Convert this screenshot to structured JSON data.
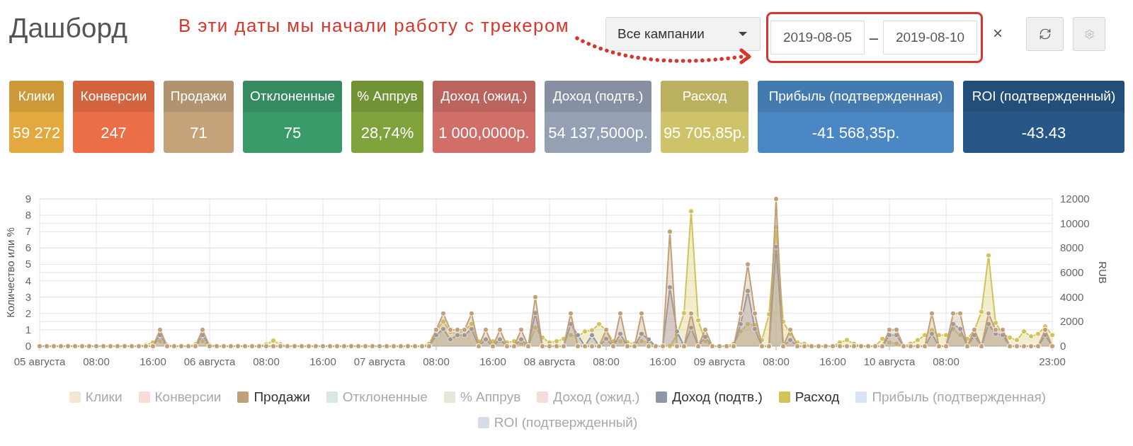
{
  "page": {
    "title": "Дашборд"
  },
  "annotation": {
    "text": "В эти даты мы начали работу с трекером"
  },
  "filters": {
    "campaign": {
      "value": "Все кампании"
    },
    "date_from": {
      "value": "2019-08-05"
    },
    "separator": "–",
    "date_to": {
      "value": "2019-08-10"
    },
    "clear": "×"
  },
  "metrics": [
    {
      "label": "Клики",
      "value": "59 272",
      "color": "#e3a93e"
    },
    {
      "label": "Конверсии",
      "value": "247",
      "color": "#ec6e46"
    },
    {
      "label": "Продажи",
      "value": "71",
      "color": "#c4a37b"
    },
    {
      "label": "Отклоненные",
      "value": "75",
      "color": "#3b9a69"
    },
    {
      "label": "% Аппрув",
      "value": "28,74%",
      "color": "#7fa23c"
    },
    {
      "label": "Доход (ожид.)",
      "value": "1 000,0000р.",
      "color": "#d06e67"
    },
    {
      "label": "Доход (подтв.)",
      "value": "54 137,5000р.",
      "color": "#95a0b4"
    },
    {
      "label": "Расход",
      "value": "95 705,85р.",
      "color": "#cfc369"
    },
    {
      "label": "Прибыль (подтвержденная)",
      "value": "-41 568,35р.",
      "color": "#4a87c4"
    },
    {
      "label": "ROI (подтвержденный)",
      "value": "-43.43",
      "color": "#275787"
    }
  ],
  "chart": {
    "chart_data": {
      "type": "area",
      "stacked": false,
      "grid": true,
      "legend": "bottom",
      "ylabel": "Количество или %",
      "y2label": "RUB",
      "x": [
        "2019-08-05T00:00",
        "2019-08-05T01:00",
        "2019-08-05T02:00",
        "2019-08-05T03:00",
        "2019-08-05T04:00",
        "2019-08-05T05:00",
        "2019-08-05T06:00",
        "2019-08-05T07:00",
        "2019-08-05T08:00",
        "2019-08-05T09:00",
        "2019-08-05T10:00",
        "2019-08-05T11:00",
        "2019-08-05T12:00",
        "2019-08-05T13:00",
        "2019-08-05T14:00",
        "2019-08-05T15:00",
        "2019-08-05T16:00",
        "2019-08-05T17:00",
        "2019-08-05T18:00",
        "2019-08-05T19:00",
        "2019-08-05T20:00",
        "2019-08-05T21:00",
        "2019-08-05T22:00",
        "2019-08-05T23:00",
        "2019-08-06T00:00",
        "2019-08-06T01:00",
        "2019-08-06T02:00",
        "2019-08-06T03:00",
        "2019-08-06T04:00",
        "2019-08-06T05:00",
        "2019-08-06T06:00",
        "2019-08-06T07:00",
        "2019-08-06T08:00",
        "2019-08-06T09:00",
        "2019-08-06T10:00",
        "2019-08-06T11:00",
        "2019-08-06T12:00",
        "2019-08-06T13:00",
        "2019-08-06T14:00",
        "2019-08-06T15:00",
        "2019-08-06T16:00",
        "2019-08-06T17:00",
        "2019-08-06T18:00",
        "2019-08-06T19:00",
        "2019-08-06T20:00",
        "2019-08-06T21:00",
        "2019-08-06T22:00",
        "2019-08-06T23:00",
        "2019-08-07T00:00",
        "2019-08-07T01:00",
        "2019-08-07T02:00",
        "2019-08-07T03:00",
        "2019-08-07T04:00",
        "2019-08-07T05:00",
        "2019-08-07T06:00",
        "2019-08-07T07:00",
        "2019-08-07T08:00",
        "2019-08-07T09:00",
        "2019-08-07T10:00",
        "2019-08-07T11:00",
        "2019-08-07T12:00",
        "2019-08-07T13:00",
        "2019-08-07T14:00",
        "2019-08-07T15:00",
        "2019-08-07T16:00",
        "2019-08-07T17:00",
        "2019-08-07T18:00",
        "2019-08-07T19:00",
        "2019-08-07T20:00",
        "2019-08-07T21:00",
        "2019-08-07T22:00",
        "2019-08-07T23:00",
        "2019-08-08T00:00",
        "2019-08-08T01:00",
        "2019-08-08T02:00",
        "2019-08-08T03:00",
        "2019-08-08T04:00",
        "2019-08-08T05:00",
        "2019-08-08T06:00",
        "2019-08-08T07:00",
        "2019-08-08T08:00",
        "2019-08-08T09:00",
        "2019-08-08T10:00",
        "2019-08-08T11:00",
        "2019-08-08T12:00",
        "2019-08-08T13:00",
        "2019-08-08T14:00",
        "2019-08-08T15:00",
        "2019-08-08T16:00",
        "2019-08-08T17:00",
        "2019-08-08T18:00",
        "2019-08-08T19:00",
        "2019-08-08T20:00",
        "2019-08-08T21:00",
        "2019-08-08T22:00",
        "2019-08-08T23:00",
        "2019-08-09T00:00",
        "2019-08-09T01:00",
        "2019-08-09T02:00",
        "2019-08-09T03:00",
        "2019-08-09T04:00",
        "2019-08-09T05:00",
        "2019-08-09T06:00",
        "2019-08-09T07:00",
        "2019-08-09T08:00",
        "2019-08-09T09:00",
        "2019-08-09T10:00",
        "2019-08-09T11:00",
        "2019-08-09T12:00",
        "2019-08-09T13:00",
        "2019-08-09T14:00",
        "2019-08-09T15:00",
        "2019-08-09T16:00",
        "2019-08-09T17:00",
        "2019-08-09T18:00",
        "2019-08-09T19:00",
        "2019-08-09T20:00",
        "2019-08-09T21:00",
        "2019-08-09T22:00",
        "2019-08-09T23:00",
        "2019-08-10T00:00",
        "2019-08-10T01:00",
        "2019-08-10T02:00",
        "2019-08-10T03:00",
        "2019-08-10T04:00",
        "2019-08-10T05:00",
        "2019-08-10T06:00",
        "2019-08-10T07:00",
        "2019-08-10T08:00",
        "2019-08-10T09:00",
        "2019-08-10T10:00",
        "2019-08-10T11:00",
        "2019-08-10T12:00",
        "2019-08-10T13:00",
        "2019-08-10T14:00",
        "2019-08-10T15:00",
        "2019-08-10T16:00",
        "2019-08-10T17:00",
        "2019-08-10T18:00",
        "2019-08-10T19:00",
        "2019-08-10T20:00",
        "2019-08-10T21:00",
        "2019-08-10T22:00",
        "2019-08-10T23:00"
      ],
      "xlim": [
        "2019-08-05T00:00",
        "2019-08-10T23:00"
      ],
      "xticks": [
        {
          "value": "2019-08-05T00:00",
          "label": "05 августа"
        },
        {
          "value": "2019-08-05T08:00",
          "label": "08:00"
        },
        {
          "value": "2019-08-05T16:00",
          "label": "16:00"
        },
        {
          "value": "2019-08-06T00:00",
          "label": "06 августа"
        },
        {
          "value": "2019-08-06T08:00",
          "label": "08:00"
        },
        {
          "value": "2019-08-06T16:00",
          "label": "16:00"
        },
        {
          "value": "2019-08-07T00:00",
          "label": "07 августа"
        },
        {
          "value": "2019-08-07T08:00",
          "label": "08:00"
        },
        {
          "value": "2019-08-07T16:00",
          "label": "16:00"
        },
        {
          "value": "2019-08-08T00:00",
          "label": "08 августа"
        },
        {
          "value": "2019-08-08T08:00",
          "label": "08:00"
        },
        {
          "value": "2019-08-08T16:00",
          "label": "16:00"
        },
        {
          "value": "2019-08-09T00:00",
          "label": "09 августа"
        },
        {
          "value": "2019-08-09T08:00",
          "label": "08:00"
        },
        {
          "value": "2019-08-09T16:00",
          "label": "16:00"
        },
        {
          "value": "2019-08-10T00:00",
          "label": "10 августа"
        },
        {
          "value": "2019-08-10T08:00",
          "label": "08:00"
        },
        {
          "value": "2019-08-10T23:00",
          "label": "23:00"
        }
      ],
      "ylim": [
        0,
        9
      ],
      "yticks": [
        0,
        1,
        2,
        3,
        4,
        5,
        6,
        7,
        8,
        9
      ],
      "y2lim": [
        0,
        12000
      ],
      "y2ticks": [
        0,
        2000,
        4000,
        6000,
        8000,
        10000,
        12000
      ],
      "series": [
        {
          "name": "Клики",
          "color": "#f5e7cf",
          "values": [
            null,
            null,
            null,
            null,
            null,
            null,
            null,
            null,
            null,
            null,
            null,
            null,
            null,
            null,
            null,
            null,
            null,
            null,
            null,
            null,
            null,
            null,
            null,
            null,
            null,
            null,
            null,
            null,
            null,
            null,
            null,
            null,
            null,
            null,
            null,
            null,
            null,
            null,
            null,
            null,
            null,
            null,
            null,
            null,
            null,
            null,
            null,
            null,
            null,
            null,
            null,
            null,
            null,
            null,
            null,
            null,
            null,
            null,
            null,
            null,
            null,
            null,
            null,
            null,
            null,
            null,
            null,
            null,
            null,
            null,
            null,
            null,
            null,
            null,
            null,
            null,
            null,
            null,
            null,
            null,
            null,
            null,
            null,
            null,
            null,
            null,
            null,
            null,
            null,
            null,
            null,
            null,
            null,
            null,
            null,
            null,
            null,
            null,
            null,
            null,
            null,
            null,
            null,
            null,
            null,
            null,
            null,
            null,
            null,
            null,
            null,
            null,
            null,
            null,
            null,
            null,
            null,
            null,
            null,
            null,
            null,
            null,
            null,
            null,
            null,
            null,
            null,
            null,
            null,
            null,
            null,
            null,
            null,
            null,
            null,
            null,
            null,
            null,
            null,
            null,
            null,
            null,
            null,
            null
          ]
        },
        {
          "name": "Конверсии",
          "color": "#f9dcd3",
          "values": [
            null,
            null,
            null,
            null,
            null,
            null,
            null,
            null,
            null,
            null,
            null,
            null,
            null,
            null,
            null,
            null,
            null,
            null,
            null,
            null,
            null,
            null,
            null,
            null,
            null,
            null,
            null,
            null,
            null,
            null,
            null,
            null,
            null,
            null,
            null,
            null,
            null,
            null,
            null,
            null,
            null,
            null,
            null,
            null,
            null,
            null,
            null,
            null,
            null,
            null,
            null,
            null,
            null,
            null,
            null,
            null,
            null,
            null,
            null,
            null,
            null,
            null,
            null,
            null,
            null,
            null,
            null,
            null,
            null,
            null,
            null,
            null,
            null,
            null,
            null,
            null,
            null,
            null,
            null,
            null,
            null,
            null,
            null,
            null,
            null,
            null,
            null,
            null,
            null,
            null,
            null,
            null,
            null,
            null,
            null,
            null,
            null,
            null,
            null,
            null,
            null,
            null,
            null,
            null,
            null,
            null,
            null,
            null,
            null,
            null,
            null,
            null,
            null,
            null,
            null,
            null,
            null,
            null,
            null,
            null,
            null,
            null,
            null,
            null,
            null,
            null,
            null,
            null,
            null,
            null,
            null,
            null,
            null,
            null,
            null,
            null,
            null,
            null,
            null,
            null,
            null,
            null,
            null,
            null
          ]
        },
        {
          "name": "Продажи",
          "color": "#c2a077",
          "values": [
            0,
            0,
            0,
            0,
            0,
            0,
            0,
            0,
            0,
            0,
            0,
            0,
            0,
            0,
            0,
            0,
            0,
            1,
            0,
            0,
            0,
            0,
            0,
            1,
            0,
            0,
            0,
            0,
            0,
            0,
            0,
            0,
            0,
            0,
            0,
            0,
            0,
            0,
            0,
            0,
            0,
            0,
            0,
            0,
            0,
            0,
            0,
            0,
            0,
            0,
            0,
            0,
            0,
            0,
            0,
            0,
            1,
            2,
            1,
            1,
            1,
            2,
            0,
            1,
            0,
            1,
            0,
            0,
            1,
            0,
            3,
            0,
            0,
            0,
            0,
            2,
            0,
            0,
            0,
            0,
            1,
            0,
            2,
            0,
            0,
            2,
            0,
            0,
            0,
            7,
            0,
            0,
            2,
            0,
            1,
            0,
            0,
            0,
            0,
            2,
            5,
            2,
            0,
            0,
            9,
            0,
            1,
            0,
            0,
            0,
            0,
            0,
            0,
            0,
            0,
            0,
            0,
            0,
            0,
            0,
            1,
            1,
            0,
            0,
            0,
            0,
            2,
            0,
            0,
            2,
            2,
            0,
            1,
            0,
            2,
            1,
            1,
            0,
            0,
            0,
            0,
            0,
            1,
            0
          ]
        },
        {
          "name": "Отклоненные",
          "color": "#d6ebe0",
          "values": [
            null,
            null,
            null,
            null,
            null,
            null,
            null,
            null,
            null,
            null,
            null,
            null,
            null,
            null,
            null,
            null,
            null,
            null,
            null,
            null,
            null,
            null,
            null,
            null,
            null,
            null,
            null,
            null,
            null,
            null,
            null,
            null,
            null,
            null,
            null,
            null,
            null,
            null,
            null,
            null,
            null,
            null,
            null,
            null,
            null,
            null,
            null,
            null,
            null,
            null,
            null,
            null,
            null,
            null,
            null,
            null,
            null,
            null,
            null,
            null,
            null,
            null,
            null,
            null,
            null,
            null,
            null,
            null,
            null,
            null,
            null,
            null,
            null,
            null,
            null,
            null,
            null,
            null,
            null,
            null,
            null,
            null,
            null,
            null,
            null,
            null,
            null,
            null,
            null,
            null,
            null,
            null,
            null,
            null,
            null,
            null,
            null,
            null,
            null,
            null,
            null,
            null,
            null,
            null,
            null,
            null,
            null,
            null,
            null,
            null,
            null,
            null,
            null,
            null,
            null,
            null,
            null,
            null,
            null,
            null,
            null,
            null,
            null,
            null,
            null,
            null,
            null,
            null,
            null,
            null,
            null,
            null,
            null,
            null,
            null,
            null,
            null,
            null,
            null,
            null,
            null,
            null,
            null,
            null
          ]
        },
        {
          "name": "% Аппрув",
          "color": "#e3e9d3",
          "values": [
            null,
            null,
            null,
            null,
            null,
            null,
            null,
            null,
            null,
            null,
            null,
            null,
            null,
            null,
            null,
            null,
            null,
            null,
            null,
            null,
            null,
            null,
            null,
            null,
            null,
            null,
            null,
            null,
            null,
            null,
            null,
            null,
            null,
            null,
            null,
            null,
            null,
            null,
            null,
            null,
            null,
            null,
            null,
            null,
            null,
            null,
            null,
            null,
            null,
            null,
            null,
            null,
            null,
            null,
            null,
            null,
            null,
            null,
            null,
            null,
            null,
            null,
            null,
            null,
            null,
            null,
            null,
            null,
            null,
            null,
            null,
            null,
            null,
            null,
            null,
            null,
            null,
            null,
            null,
            null,
            null,
            null,
            null,
            null,
            null,
            null,
            null,
            null,
            null,
            null,
            null,
            null,
            null,
            null,
            null,
            null,
            null,
            null,
            null,
            null,
            null,
            null,
            null,
            null,
            null,
            null,
            null,
            null,
            null,
            null,
            null,
            null,
            null,
            null,
            null,
            null,
            null,
            null,
            null,
            null,
            null,
            null,
            null,
            null,
            null,
            null,
            null,
            null,
            null,
            null,
            null,
            null,
            null,
            null,
            null,
            null,
            null,
            null,
            null,
            null,
            null,
            null,
            null,
            null
          ]
        },
        {
          "name": "Доход (ожид.)",
          "color": "#f4dcd9",
          "values": [
            null,
            null,
            null,
            null,
            null,
            null,
            null,
            null,
            null,
            null,
            null,
            null,
            null,
            null,
            null,
            null,
            null,
            null,
            null,
            null,
            null,
            null,
            null,
            null,
            null,
            null,
            null,
            null,
            null,
            null,
            null,
            null,
            null,
            null,
            null,
            null,
            null,
            null,
            null,
            null,
            null,
            null,
            null,
            null,
            null,
            null,
            null,
            null,
            null,
            null,
            null,
            null,
            null,
            null,
            null,
            null,
            null,
            null,
            null,
            null,
            null,
            null,
            null,
            null,
            null,
            null,
            null,
            null,
            null,
            null,
            null,
            null,
            null,
            null,
            null,
            null,
            null,
            null,
            null,
            null,
            null,
            null,
            null,
            null,
            null,
            null,
            null,
            null,
            null,
            null,
            null,
            null,
            null,
            null,
            null,
            null,
            null,
            null,
            null,
            null,
            null,
            null,
            null,
            null,
            null,
            null,
            null,
            null,
            null,
            null,
            null,
            null,
            null,
            null,
            null,
            null,
            null,
            null,
            null,
            null,
            null,
            null,
            null,
            null,
            null,
            null,
            null,
            null,
            null,
            null,
            null,
            null,
            null,
            null,
            null,
            null,
            null,
            null,
            null,
            null,
            null,
            null,
            null,
            null
          ]
        },
        {
          "name": "Доход (подтв.)",
          "color": "#8e96a8",
          "axis": "y2",
          "values": [
            0,
            0,
            0,
            0,
            0,
            0,
            0,
            0,
            0,
            0,
            0,
            0,
            0,
            0,
            0,
            0,
            0,
            900,
            0,
            0,
            0,
            0,
            0,
            900,
            0,
            0,
            0,
            0,
            0,
            0,
            0,
            0,
            0,
            0,
            0,
            0,
            0,
            0,
            0,
            0,
            0,
            0,
            0,
            0,
            0,
            0,
            0,
            0,
            0,
            0,
            0,
            0,
            0,
            0,
            0,
            0,
            900,
            1400,
            550,
            900,
            900,
            1400,
            0,
            550,
            0,
            550,
            0,
            0,
            550,
            0,
            2700,
            0,
            0,
            0,
            0,
            1800,
            900,
            0,
            900,
            0,
            600,
            0,
            1000,
            0,
            0,
            1000,
            550,
            0,
            0,
            4800,
            1200,
            0,
            1500,
            0,
            750,
            0,
            0,
            0,
            0,
            1800,
            4500,
            1400,
            0,
            0,
            8100,
            0,
            500,
            0,
            0,
            0,
            0,
            0,
            0,
            0,
            0,
            0,
            0,
            0,
            0,
            0,
            900,
            900,
            0,
            0,
            0,
            0,
            1000,
            0,
            0,
            1800,
            1400,
            0,
            900,
            0,
            1800,
            1000,
            900,
            0,
            0,
            0,
            0,
            0,
            900,
            0
          ]
        },
        {
          "name": "Расход",
          "color": "#d2c25a",
          "axis": "y2",
          "values": [
            0,
            0,
            0,
            0,
            0,
            0,
            0,
            0,
            0,
            0,
            0,
            0,
            0,
            0,
            0,
            100,
            300,
            400,
            100,
            0,
            0,
            0,
            150,
            400,
            100,
            0,
            0,
            0,
            0,
            0,
            0,
            0,
            150,
            450,
            150,
            0,
            0,
            0,
            0,
            0,
            0,
            0,
            0,
            0,
            0,
            0,
            0,
            0,
            0,
            0,
            0,
            0,
            0,
            0,
            0,
            200,
            1300,
            2000,
            1150,
            1000,
            1300,
            1800,
            400,
            500,
            400,
            400,
            300,
            400,
            200,
            0,
            1500,
            700,
            300,
            400,
            600,
            900,
            800,
            1200,
            1300,
            1800,
            1300,
            400,
            400,
            300,
            200,
            400,
            300,
            0,
            0,
            0,
            900,
            2700,
            11000,
            2100,
            400,
            0,
            0,
            0,
            200,
            1200,
            1800,
            1700,
            500,
            2600,
            9700,
            2000,
            1000,
            300,
            200,
            0,
            0,
            0,
            0,
            300,
            500,
            200,
            0,
            0,
            0,
            600,
            300,
            200,
            0,
            200,
            500,
            900,
            1300,
            900,
            900,
            1400,
            900,
            600,
            1300,
            2800,
            7400,
            1900,
            1000,
            700,
            500,
            1200,
            800,
            1000,
            1600,
            900
          ]
        },
        {
          "name": "Прибыль (подтвержденная)",
          "color": "#dae4f0",
          "values": [
            null,
            null,
            null,
            null,
            null,
            null,
            null,
            null,
            null,
            null,
            null,
            null,
            null,
            null,
            null,
            null,
            null,
            null,
            null,
            null,
            null,
            null,
            null,
            null,
            null,
            null,
            null,
            null,
            null,
            null,
            null,
            null,
            null,
            null,
            null,
            null,
            null,
            null,
            null,
            null,
            null,
            null,
            null,
            null,
            null,
            null,
            null,
            null,
            null,
            null,
            null,
            null,
            null,
            null,
            null,
            null,
            null,
            null,
            null,
            null,
            null,
            null,
            null,
            null,
            null,
            null,
            null,
            null,
            null,
            null,
            null,
            null,
            null,
            null,
            null,
            null,
            null,
            null,
            null,
            null,
            null,
            null,
            null,
            null,
            null,
            null,
            null,
            null,
            null,
            null,
            null,
            null,
            null,
            null,
            null,
            null,
            null,
            null,
            null,
            null,
            null,
            null,
            null,
            null,
            null,
            null,
            null,
            null,
            null,
            null,
            null,
            null,
            null,
            null,
            null,
            null,
            null,
            null,
            null,
            null,
            null,
            null,
            null,
            null,
            null,
            null,
            null,
            null,
            null,
            null,
            null,
            null,
            null,
            null,
            null,
            null,
            null,
            null,
            null,
            null,
            null,
            null,
            null,
            null
          ]
        },
        {
          "name": "ROI (подтвержденный)",
          "color": "#d4dde8",
          "values": [
            null,
            null,
            null,
            null,
            null,
            null,
            null,
            null,
            null,
            null,
            null,
            null,
            null,
            null,
            null,
            null,
            null,
            null,
            null,
            null,
            null,
            null,
            null,
            null,
            null,
            null,
            null,
            null,
            null,
            null,
            null,
            null,
            null,
            null,
            null,
            null,
            null,
            null,
            null,
            null,
            null,
            null,
            null,
            null,
            null,
            null,
            null,
            null,
            null,
            null,
            null,
            null,
            null,
            null,
            null,
            null,
            null,
            null,
            null,
            null,
            null,
            null,
            null,
            null,
            null,
            null,
            null,
            null,
            null,
            null,
            null,
            null,
            null,
            null,
            null,
            null,
            null,
            null,
            null,
            null,
            null,
            null,
            null,
            null,
            null,
            null,
            null,
            null,
            null,
            null,
            null,
            null,
            null,
            null,
            null,
            null,
            null,
            null,
            null,
            null,
            null,
            null,
            null,
            null,
            null,
            null,
            null,
            null,
            null,
            null,
            null,
            null,
            null,
            null,
            null,
            null,
            null,
            null,
            null,
            null,
            null,
            null,
            null,
            null,
            null,
            null,
            null,
            null,
            null,
            null,
            null,
            null,
            null,
            null,
            null,
            null,
            null,
            null,
            null,
            null,
            null,
            null,
            null,
            null
          ]
        }
      ]
    },
    "legend_items": [
      {
        "on": false
      },
      {
        "on": false
      },
      {
        "on": true
      },
      {
        "on": false
      },
      {
        "on": false
      },
      {
        "on": false
      },
      {
        "on": true
      },
      {
        "on": true
      },
      {
        "on": false
      },
      {
        "on": false
      }
    ]
  }
}
